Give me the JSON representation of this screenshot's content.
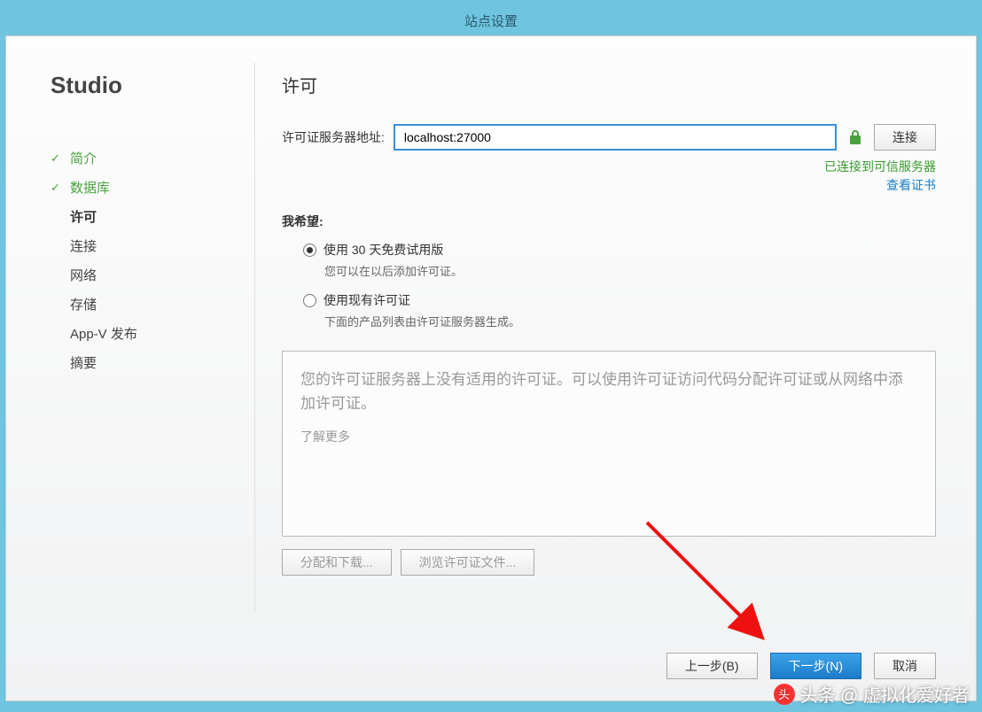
{
  "window": {
    "title": "站点设置"
  },
  "sidebar": {
    "title": "Studio",
    "items": [
      {
        "label": "简介",
        "state": "done"
      },
      {
        "label": "数据库",
        "state": "done"
      },
      {
        "label": "许可",
        "state": "current"
      },
      {
        "label": "连接",
        "state": "pending"
      },
      {
        "label": "网络",
        "state": "pending"
      },
      {
        "label": "存储",
        "state": "pending"
      },
      {
        "label": "App-V 发布",
        "state": "pending"
      },
      {
        "label": "摘要",
        "state": "pending"
      }
    ]
  },
  "main": {
    "heading": "许可",
    "server_label": "许可证服务器地址:",
    "server_value": "localhost:27000",
    "connect_label": "连接",
    "status_connected": "已连接到可信服务器",
    "view_cert": "查看证书",
    "want_label": "我希望:",
    "options": [
      {
        "label": "使用 30 天免费试用版",
        "sub": "您可以在以后添加许可证。",
        "selected": true
      },
      {
        "label": "使用现有许可证",
        "sub": "下面的产品列表由许可证服务器生成。",
        "selected": false
      }
    ],
    "license_box_msg": "您的许可证服务器上没有适用的许可证。可以使用许可证访问代码分配许可证或从网络中添加许可证。",
    "learn_more": "了解更多",
    "allocate_btn": "分配和下载...",
    "browse_btn": "浏览许可证文件..."
  },
  "footer": {
    "back": "上一步(B)",
    "next": "下一步(N)",
    "cancel": "取消"
  },
  "watermark": "头条 @ 虚拟化爱好者"
}
